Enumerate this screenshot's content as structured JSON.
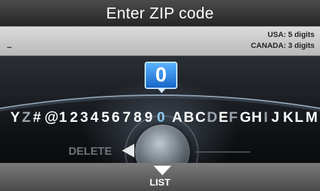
{
  "header": {
    "title": "Enter ZIP code"
  },
  "entry": {
    "cursor": "–",
    "hints": [
      "USA: 5 digits",
      "CANADA: 3 digits"
    ]
  },
  "selector": {
    "selected_char": "0",
    "characters": [
      {
        "c": "Y",
        "state": "normal"
      },
      {
        "c": "Z",
        "state": "dim"
      },
      {
        "c": "#",
        "state": "normal"
      },
      {
        "c": "@",
        "state": "normal"
      },
      {
        "c": "1",
        "state": "normal"
      },
      {
        "c": "2",
        "state": "normal"
      },
      {
        "c": "3",
        "state": "normal"
      },
      {
        "c": "4",
        "state": "normal"
      },
      {
        "c": "5",
        "state": "normal"
      },
      {
        "c": "6",
        "state": "normal"
      },
      {
        "c": "7",
        "state": "normal"
      },
      {
        "c": "8",
        "state": "normal"
      },
      {
        "c": "9",
        "state": "normal"
      },
      {
        "c": "0",
        "state": "selected"
      },
      {
        "c": "A",
        "state": "normal"
      },
      {
        "c": "B",
        "state": "normal"
      },
      {
        "c": "C",
        "state": "normal"
      },
      {
        "c": "D",
        "state": "dim"
      },
      {
        "c": "E",
        "state": "normal"
      },
      {
        "c": "F",
        "state": "dim"
      },
      {
        "c": "G",
        "state": "normal"
      },
      {
        "c": "H",
        "state": "normal"
      },
      {
        "c": "I",
        "state": "dim"
      },
      {
        "c": "J",
        "state": "normal"
      },
      {
        "c": "K",
        "state": "normal"
      },
      {
        "c": "L",
        "state": "normal"
      },
      {
        "c": "M",
        "state": "normal"
      }
    ]
  },
  "controls": {
    "delete_label": "DELETE",
    "list_label": "LIST"
  },
  "colors": {
    "selection": "#1f7fe0",
    "selected_text": "#8fd0ff",
    "dim_text": "#9aa3ab"
  }
}
